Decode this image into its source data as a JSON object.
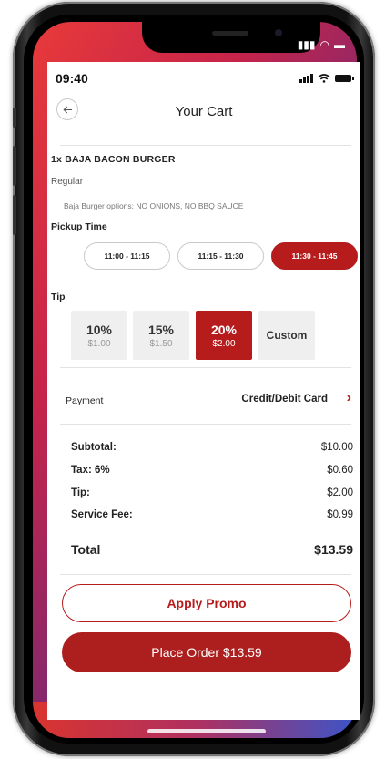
{
  "status_bar": {
    "time": "09:40"
  },
  "header": {
    "title": "Your Cart",
    "back_icon": "arrow-left-icon"
  },
  "cart_item": {
    "name": "1x  BAJA BACON BURGER",
    "size": "Regular",
    "options": "Baja Burger options:   NO ONIONS, NO BBQ SAUCE"
  },
  "pickup": {
    "label": "Pickup Time",
    "slots": [
      "11:00 - 11:15",
      "11:15 - 11:30",
      "11:30 - 11:45"
    ],
    "selected_index": 2
  },
  "tip": {
    "label": "Tip",
    "options": [
      {
        "pct": "10%",
        "amount": "$1.00"
      },
      {
        "pct": "15%",
        "amount": "$1.50"
      },
      {
        "pct": "20%",
        "amount": "$2.00"
      }
    ],
    "custom_label": "Custom",
    "selected_index": 2
  },
  "payment": {
    "label": "Payment",
    "value": "Credit/Debit Card"
  },
  "summary": {
    "rows": [
      {
        "label": "Subtotal:",
        "value": "$10.00"
      },
      {
        "label": "Tax: 6%",
        "value": "$0.60"
      },
      {
        "label": "Tip:",
        "value": "$2.00"
      },
      {
        "label": "Service Fee:",
        "value": "$0.99"
      }
    ],
    "total_label": "Total",
    "total_value": "$13.59"
  },
  "actions": {
    "promo_label": "Apply Promo",
    "order_label": "Place Order $13.59"
  },
  "colors": {
    "accent": "#b71c1c",
    "tile_bg": "#efefef"
  }
}
